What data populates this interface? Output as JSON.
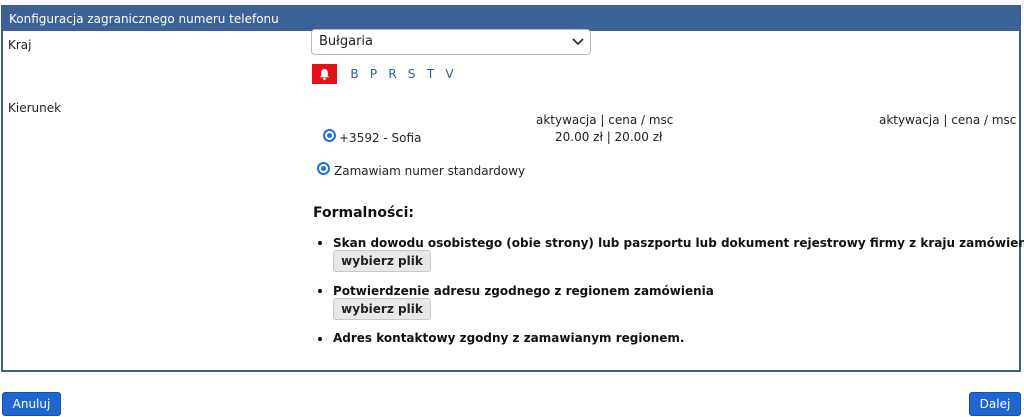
{
  "panel": {
    "title": "Konfiguracja zagranicznego numeru telefonu"
  },
  "country": {
    "label": "Kraj",
    "selected": "Bułgaria"
  },
  "alphabet": {
    "letters": [
      "B",
      "P",
      "R",
      "S",
      "T",
      "V"
    ]
  },
  "direction": {
    "label": "Kierunek",
    "column_header_left": "aktywacja | cena / msc",
    "column_header_right": "aktywacja | cena / msc",
    "numbers": [
      {
        "number": "+3592 - Sofia",
        "price": "20.00 zł | 20.00 zł",
        "selected": true
      }
    ],
    "standard_option": "Zamawiam numer standardowy"
  },
  "formalities": {
    "title": "Formalności:",
    "items": [
      {
        "text": "Skan dowodu osobistego (obie strony) lub paszportu lub dokument rejestrowy firmy z kraju zamówienia",
        "button": "wybierz plik"
      },
      {
        "text": "Potwierdzenie adresu zgodnego z regionem zamówienia",
        "button": "wybierz plik"
      },
      {
        "text": "Adres kontaktowy zgodny z zamawianym regionem."
      }
    ]
  },
  "footer": {
    "cancel_label": "Anuluj",
    "next_label": "Dalej"
  },
  "colors": {
    "header_bg": "#3b6197",
    "accent_blue": "#1e66d0",
    "bell_bg": "#e8101a",
    "link_blue": "#2a5fa8"
  },
  "icons": {
    "bell": "bell-icon",
    "dropdown": "chevron-down-icon"
  }
}
